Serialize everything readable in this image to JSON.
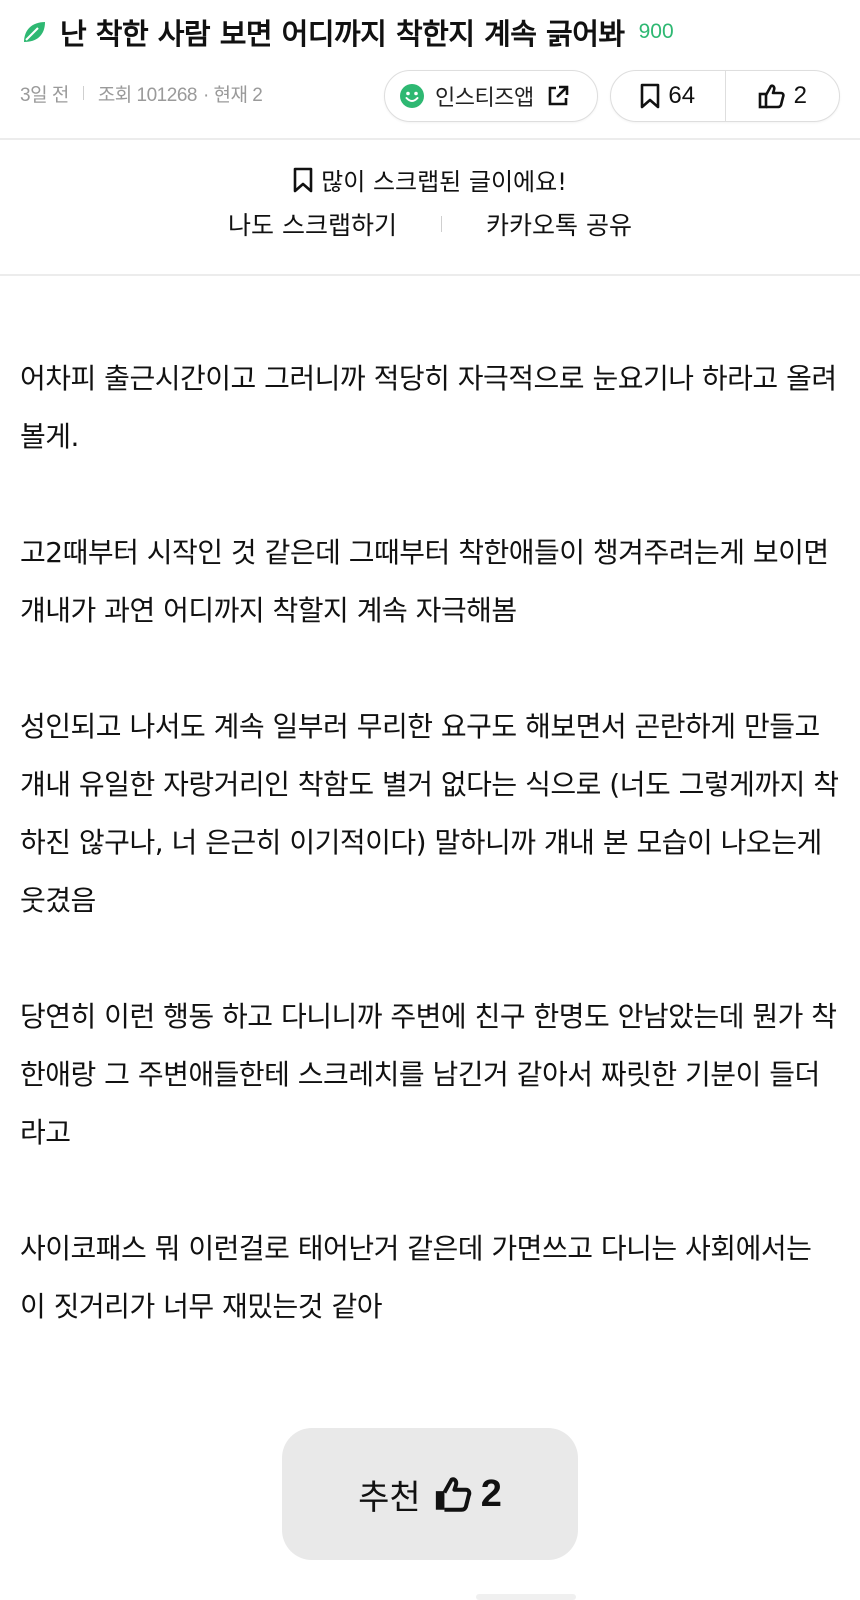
{
  "post": {
    "title": "난 착한 사람 보면 어디까지 착한지 계속 긁어봐",
    "comment_count": "900",
    "age": "3일 전",
    "views": "조회 101268",
    "current_viewers": "· 현재 2"
  },
  "actions": {
    "app_label": "인스티즈앱",
    "scrap_count": "64",
    "like_count": "2"
  },
  "scrap": {
    "notice": "많이 스크랩된 글이에요!",
    "scrap_me": "나도 스크랩하기",
    "kakao_share": "카카오톡 공유"
  },
  "content": {
    "paragraphs": [
      "어차피 출근시간이고 그러니까 적당히 자극적으로 눈요기나 하라고 올려볼게.",
      "고2때부터 시작인 것 같은데 그때부터 착한애들이 챙겨주려는게 보이면 걔내가 과연 어디까지 착할지 계속 자극해봄",
      "성인되고 나서도 계속 일부러 무리한 요구도 해보면서 곤란하게 만들고 걔내 유일한 자랑거리인 착함도 별거 없다는 식으로 (너도 그렇게까지 착하진 않구나, 너 은근히 이기적이다) 말하니까 걔내 본 모습이 나오는게 웃겼음",
      "당연히 이런 행동 하고 다니니까 주변에 친구 한명도 안남았는데 뭔가 착한애랑 그 주변애들한테 스크레치를 남긴거 같아서 짜릿한 기분이 들더라고",
      "사이코패스 뭐 이런걸로 태어난거 같은데 가면쓰고 다니는 사회에서는 이 짓거리가 너무 재밌는것 같아"
    ]
  },
  "recommend": {
    "label": "추천",
    "count": "2"
  },
  "colors": {
    "accent_green": "#2eb872",
    "meta_gray": "#9a9a9a",
    "button_bg": "#e9e9e9"
  },
  "icons": {
    "title": "leaf-icon",
    "app": "smile-icon",
    "external": "external-link-icon",
    "scrap": "bookmark-icon",
    "like": "thumbs-up-icon"
  }
}
